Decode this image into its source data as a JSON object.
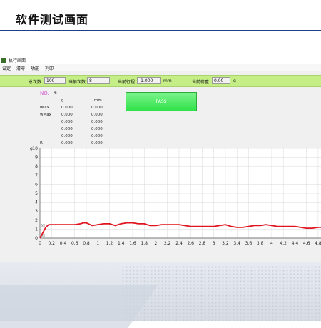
{
  "slide": {
    "title": "软件测试画面"
  },
  "app": {
    "window_title": "执行画面",
    "menu": [
      "设定",
      "清零",
      "功能",
      "列印"
    ],
    "toolbar": {
      "total_count_label": "总次数",
      "total_count_value": "100",
      "current_count_label": "当前次数",
      "current_count_value": "8",
      "current_stroke_label": "当前行程",
      "current_stroke_value": "-1.000",
      "stroke_unit": "mm",
      "current_load_label": "当前荷重",
      "current_load_value": "0.00",
      "load_unit": "g"
    },
    "status": {
      "no_label": "NO.",
      "no_value": "6",
      "result": "PASS"
    },
    "stats": {
      "col_g": "g",
      "col_mm": "mm",
      "rows": [
        {
          "label": "iMax",
          "g": "0.000",
          "mm": "0.000"
        },
        {
          "label": "wMax",
          "g": "0.000",
          "mm": "0.000"
        },
        {
          "label": "",
          "g": "0.000",
          "mm": "0.000"
        },
        {
          "label": "",
          "g": "0.000",
          "mm": "0.000"
        },
        {
          "label": "",
          "g": "0.000",
          "mm": "0.000"
        },
        {
          "label": "R",
          "g": "0.000",
          "mm": "0.000"
        }
      ]
    }
  },
  "chart_data": {
    "type": "line",
    "ylabel": "g",
    "xlim": [
      0,
      4.85
    ],
    "ylim": [
      0,
      10
    ],
    "y_ticks": [
      0,
      1,
      2,
      3,
      4,
      5,
      6,
      7,
      8,
      9,
      10
    ],
    "x_ticks": [
      0,
      0.2,
      0.4,
      0.6,
      0.8,
      1,
      1.2,
      1.4,
      1.6,
      1.8,
      2,
      2.2,
      2.4,
      2.6,
      2.8,
      3,
      3.2,
      3.4,
      3.6,
      3.8,
      4,
      4.2,
      4.4,
      4.6,
      4.8
    ],
    "x_tick_labels": [
      "0",
      "0.2",
      "0.4",
      "0.6",
      "0.8",
      "1",
      "1.2",
      "1.4",
      "1.6",
      "1.8",
      "2",
      "2.2",
      "2.4",
      "2.6",
      "2.8",
      "3",
      "3.2",
      "3.4",
      "3.6",
      "3.8",
      "4",
      "4.2",
      "4.4",
      "4.6",
      "4.8"
    ],
    "annotations": [
      "ax",
      "ax"
    ],
    "grid": true,
    "series": [
      {
        "color": "#e0141e",
        "x": [
          0,
          0.05,
          0.1,
          0.15,
          0.2,
          0.3,
          0.4,
          0.5,
          0.6,
          0.7,
          0.75,
          0.8,
          0.9,
          1.0,
          1.1,
          1.2,
          1.3,
          1.4,
          1.5,
          1.6,
          1.7,
          1.8,
          1.9,
          2.0,
          2.1,
          2.2,
          2.3,
          2.4,
          2.5,
          2.6,
          2.7,
          2.8,
          2.9,
          3.0,
          3.1,
          3.2,
          3.3,
          3.4,
          3.5,
          3.6,
          3.7,
          3.8,
          3.9,
          4.0,
          4.1,
          4.2,
          4.3,
          4.4,
          4.5,
          4.6,
          4.7,
          4.8,
          4.85
        ],
        "y": [
          0,
          0.6,
          1.2,
          1.5,
          1.5,
          1.5,
          1.5,
          1.5,
          1.5,
          1.6,
          1.7,
          1.7,
          1.4,
          1.5,
          1.6,
          1.6,
          1.4,
          1.6,
          1.7,
          1.7,
          1.6,
          1.6,
          1.4,
          1.4,
          1.5,
          1.5,
          1.5,
          1.5,
          1.4,
          1.3,
          1.3,
          1.3,
          1.3,
          1.3,
          1.4,
          1.5,
          1.3,
          1.2,
          1.2,
          1.3,
          1.4,
          1.4,
          1.5,
          1.4,
          1.3,
          1.3,
          1.3,
          1.3,
          1.2,
          1.1,
          1.1,
          1.2,
          1.2
        ]
      }
    ]
  }
}
